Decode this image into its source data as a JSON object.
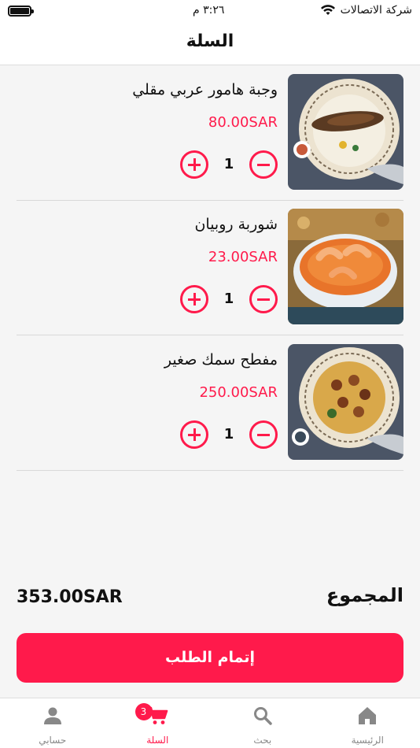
{
  "status_bar": {
    "carrier": "شركة الاتصالات",
    "time": "٣:٢٦ م"
  },
  "nav": {
    "title": "السلة"
  },
  "cart": {
    "items": [
      {
        "name": "وجبة هامور عربي  مقلي",
        "price": "80.00SAR",
        "qty": "1",
        "image": "fried-fish-rice-plate"
      },
      {
        "name": "شوربة روبيان",
        "price": "23.00SAR",
        "qty": "1",
        "image": "shrimp-soup-bowl"
      },
      {
        "name": "مفطح سمك صغير",
        "price": "250.00SAR",
        "qty": "1",
        "image": "grilled-fish-rice-platter"
      }
    ]
  },
  "summary": {
    "total_label": "المجموع",
    "total_value": "353.00SAR"
  },
  "checkout": {
    "label": "إتمام الطلب"
  },
  "tabbar": {
    "tabs": [
      {
        "label": "الرئيسية",
        "icon": "home-icon"
      },
      {
        "label": "بحث",
        "icon": "search-icon"
      },
      {
        "label": "السلة",
        "icon": "cart-icon",
        "badge": "3",
        "active": true
      },
      {
        "label": "حسابي",
        "icon": "user-icon"
      }
    ]
  },
  "colors": {
    "accent": "#ff1a4b",
    "inactive": "#888888"
  }
}
